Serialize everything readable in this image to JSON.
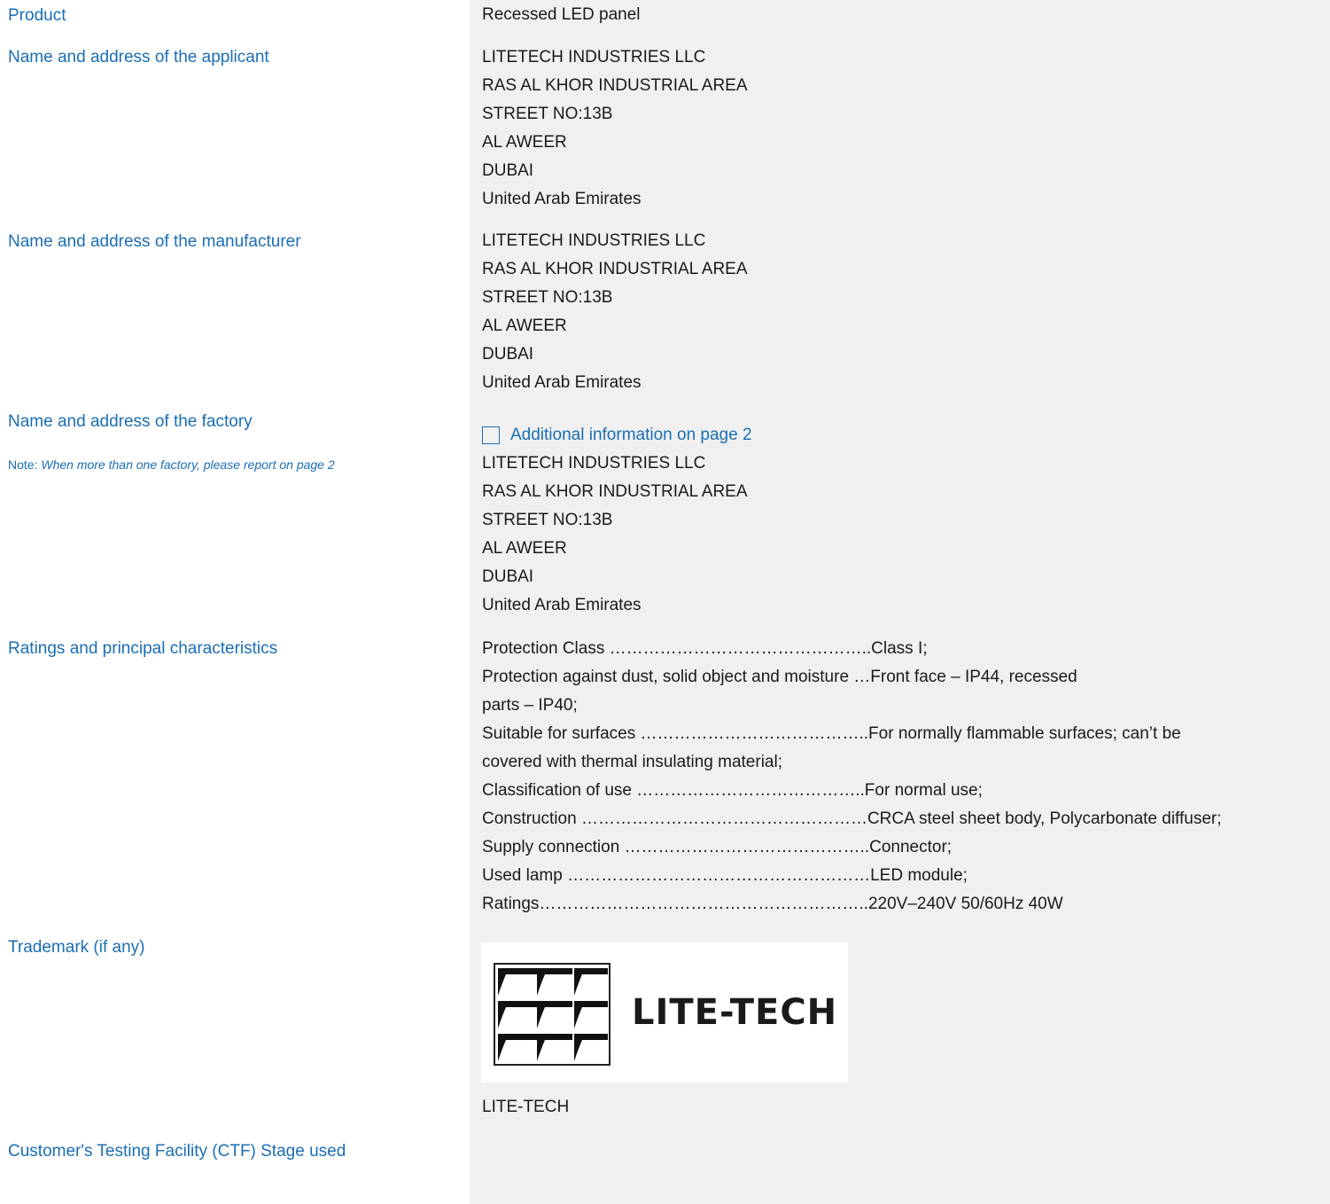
{
  "labels": {
    "product": "Product",
    "applicant": "Name and address of the applicant",
    "manufacturer": "Name and address of the manufacturer",
    "factory": "Name and address of the factory",
    "note_prefix": "Note: ",
    "note_text": "When more than one factory, please report on page 2",
    "ratings": "Ratings and principal characteristics",
    "trademark": "Trademark (if any)",
    "ctf": "Customer's Testing Facility (CTF) Stage used"
  },
  "product": "Recessed LED panel",
  "applicant": [
    "LITETECH INDUSTRIES LLC",
    "RAS AL KHOR INDUSTRIAL AREA",
    "STREET NO:13B",
    "AL AWEER",
    "DUBAI",
    "United Arab Emirates"
  ],
  "manufacturer": [
    "LITETECH INDUSTRIES LLC",
    "RAS AL KHOR INDUSTRIAL AREA",
    "STREET NO:13B",
    "AL AWEER",
    "DUBAI",
    "United Arab Emirates"
  ],
  "factory": {
    "additional_info": "Additional information on page 2",
    "additional_checked": false,
    "address": [
      "LITETECH INDUSTRIES LLC",
      "RAS AL KHOR INDUSTRIAL AREA",
      "STREET NO:13B",
      "AL AWEER",
      "DUBAI",
      "United Arab Emirates"
    ]
  },
  "ratings": [
    "Protection Class ………………………………………..Class I;",
    "Protection against dust, solid object and moisture …Front face – IP44, recessed",
    "parts – IP40;",
    "Suitable for surfaces …………………………………..For normally flammable surfaces; can’t be",
    "covered with thermal insulating material;",
    "Classification of use …………………………………..For normal use;",
    "Construction ……………………………………………CRCA steel sheet body, Polycarbonate diffuser;",
    "Supply connection ……………………………………..Connector;",
    "Used lamp ………………………………………………LED module;",
    "Ratings…………………………………………………..220V–240V 50/60Hz 40W"
  ],
  "trademark": {
    "logo_text": "LITE-TECH",
    "text": "LITE-TECH"
  },
  "ctf": ""
}
